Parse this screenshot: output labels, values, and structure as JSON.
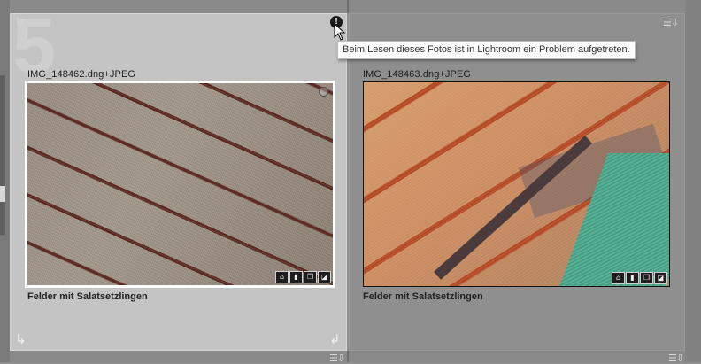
{
  "grid": {
    "cells": [
      {
        "index_number": "5",
        "filename": "IMG_148462.dng+JPEG",
        "caption": "Felder mit Salatsetzlingen",
        "selected": true,
        "flag_icon": "flag-icon",
        "rotate_left_icon": "rotate-left-icon",
        "rotate_right_icon": "rotate-right-icon",
        "badges": [
          "keyword-tag-icon",
          "comment-icon",
          "virtual-copy-icon",
          "develop-adjusted-icon"
        ]
      },
      {
        "filename": "IMG_148463.dng+JPEG",
        "caption": "Felder mit Salatsetzlingen",
        "selected": false,
        "sort_icon": "sort-menu-icon",
        "badges": [
          "keyword-tag-icon",
          "comment-icon",
          "virtual-copy-icon",
          "develop-adjusted-icon"
        ]
      }
    ]
  },
  "alert": {
    "icon": "alert-icon",
    "symbol": "!",
    "tooltip": "Beim Lesen dieses Fotos ist in Lightroom ein Problem aufgetreten."
  },
  "colors": {
    "selected_cell_bg": "#c4c4c4",
    "cell_bg": "#8f8f8f",
    "grid_bg": "#8e8e8e"
  }
}
